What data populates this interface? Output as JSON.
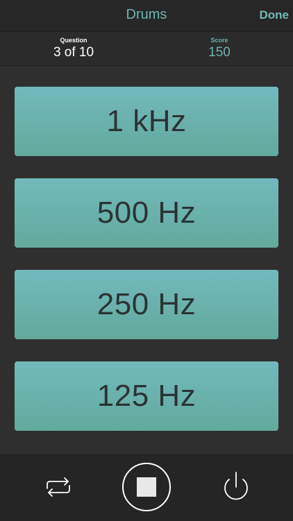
{
  "nav": {
    "title": "Drums",
    "done_label": "Done"
  },
  "stats": {
    "question_label": "Question",
    "question_value": "3 of 10",
    "score_label": "Score",
    "score_value": "150"
  },
  "answers": [
    {
      "label": "1 kHz"
    },
    {
      "label": "500 Hz"
    },
    {
      "label": "250 Hz"
    },
    {
      "label": "125 Hz"
    }
  ],
  "toolbar": {
    "repeat_icon": "repeat-icon",
    "stop_icon": "stop-icon",
    "power_icon": "power-icon"
  },
  "colors": {
    "accent": "#6cb4b2",
    "answer_gradient_top": "#72b9bd",
    "answer_gradient_bottom": "#62aa9b",
    "background": "#2f2f2f"
  }
}
